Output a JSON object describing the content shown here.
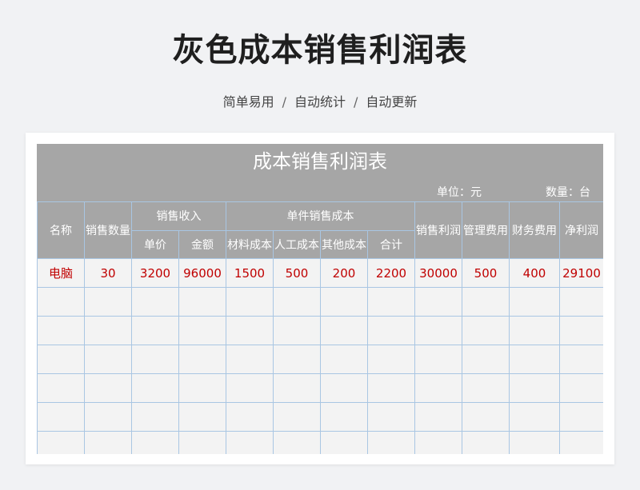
{
  "page": {
    "title": "灰色成本销售利润表",
    "subtitle_parts": [
      "简单易用",
      "自动统计",
      "自动更新"
    ],
    "separator": "/"
  },
  "sheet": {
    "title": "成本销售利润表",
    "unit_label": "单位：元",
    "quantity_label": "数量：台",
    "headers": {
      "name": "名称",
      "sales_qty": "销售数量",
      "sales_income": "销售收入",
      "unit_price": "单价",
      "amount": "金额",
      "unit_cost": "单件销售成本",
      "material_cost": "材料成本",
      "labor_cost": "人工成本",
      "other_cost": "其他成本",
      "total": "合计",
      "sales_profit": "销售利润",
      "mgmt_fee": "管理费用",
      "finance_fee": "财务费用",
      "net_profit": "净利润"
    },
    "rows": [
      [
        "电脑",
        "30",
        "3200",
        "96000",
        "1500",
        "500",
        "200",
        "2200",
        "30000",
        "500",
        "400",
        "29100"
      ]
    ],
    "empty_rows": 6
  },
  "colors": {
    "header_bg": "#a6a6a6",
    "grid": "#a9c6e3",
    "data_text": "#c00000"
  }
}
